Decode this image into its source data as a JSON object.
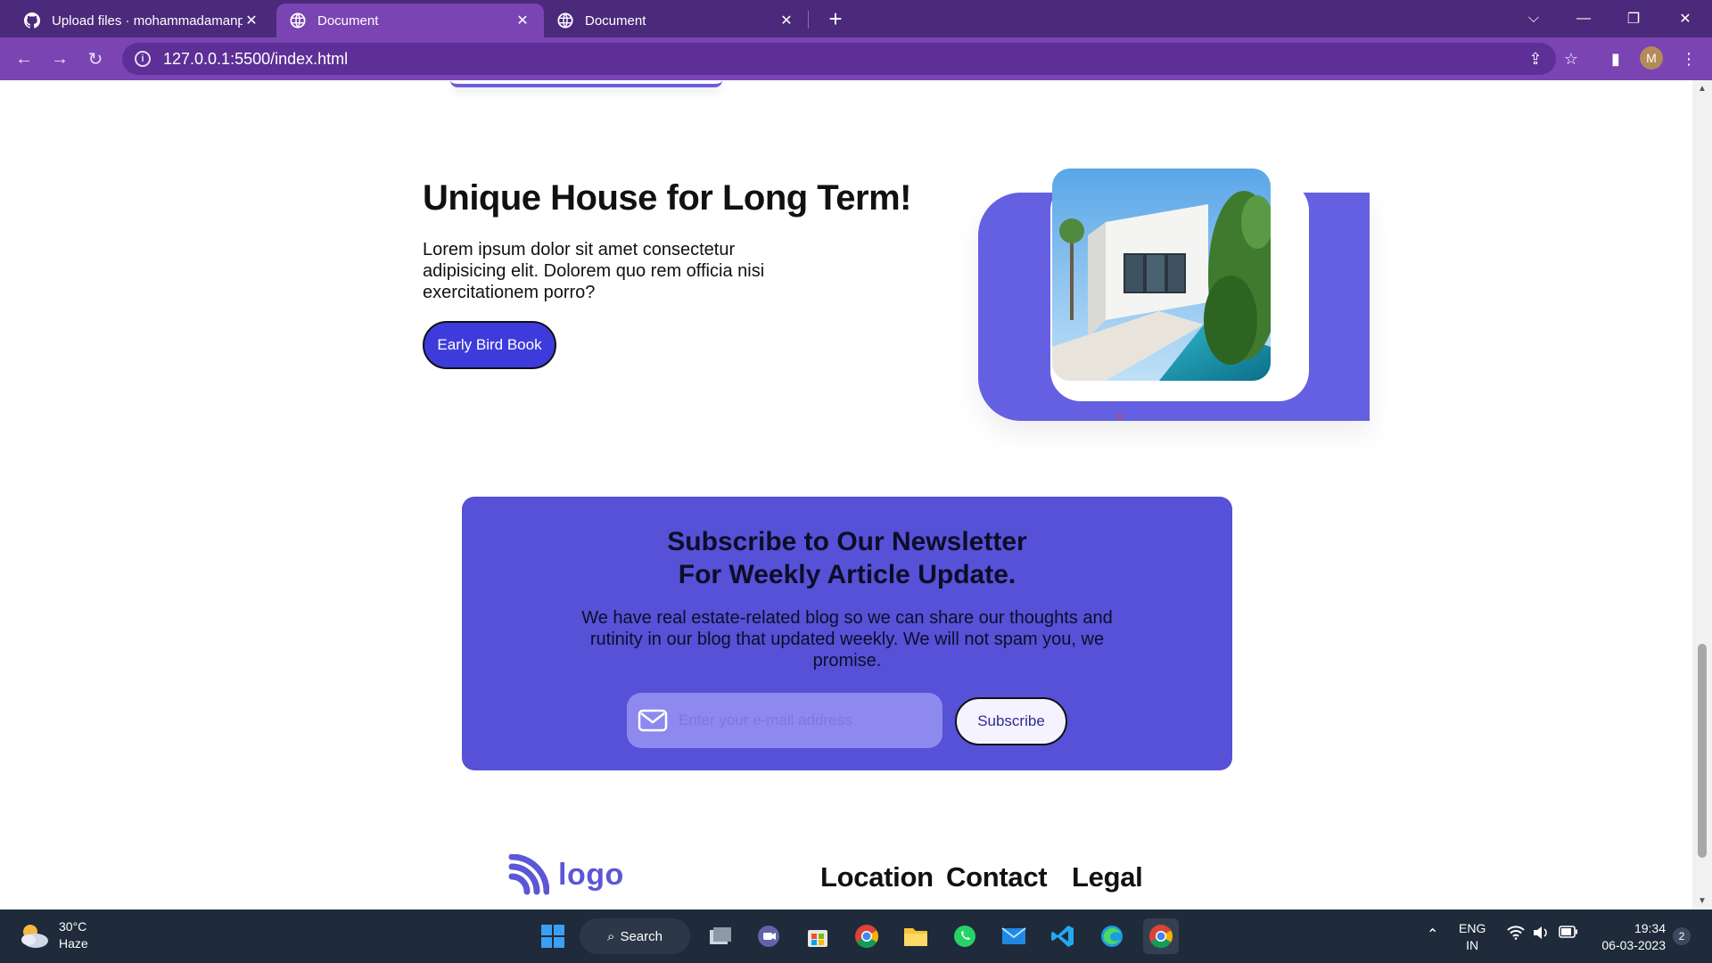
{
  "browser": {
    "tabs": [
      {
        "title": "Upload files · mohammadamanpathan",
        "icon": "github-icon"
      },
      {
        "title": "Document",
        "icon": "globe-icon",
        "active": true
      },
      {
        "title": "Document",
        "icon": "globe-icon"
      }
    ],
    "url": "127.0.0.1:5500/index.html",
    "profile_initial": "M",
    "theme_color": "#7a44b3"
  },
  "hero": {
    "title": "Unique House for Long Term!",
    "text": "Lorem ipsum dolor sit amet consectetur adipisicing elit. Dolorem quo rem officia nisi exercitationem porro?",
    "button_label": "Early Bird Book",
    "accent_color": "#6460e1"
  },
  "newsletter": {
    "title_line1": "Subscribe to Our Newsletter",
    "title_line2": "For Weekly Article Update.",
    "text": "We have real estate-related blog so we can share our thoughts and rutinity in our blog that updated weekly. We will not spam you, we promise.",
    "input_placeholder": "Enter your e-mail address",
    "button_label": "Subscribe",
    "background_color": "#5651d6"
  },
  "footer": {
    "logo_text": "logo",
    "links": [
      "Location",
      "Contact",
      "Legal"
    ]
  },
  "taskbar": {
    "weather_temp": "30°C",
    "weather_desc": "Haze",
    "search_label": "Search",
    "lang_line1": "ENG",
    "lang_line2": "IN",
    "time": "19:34",
    "date": "06-03-2023",
    "notification_count": "2"
  }
}
